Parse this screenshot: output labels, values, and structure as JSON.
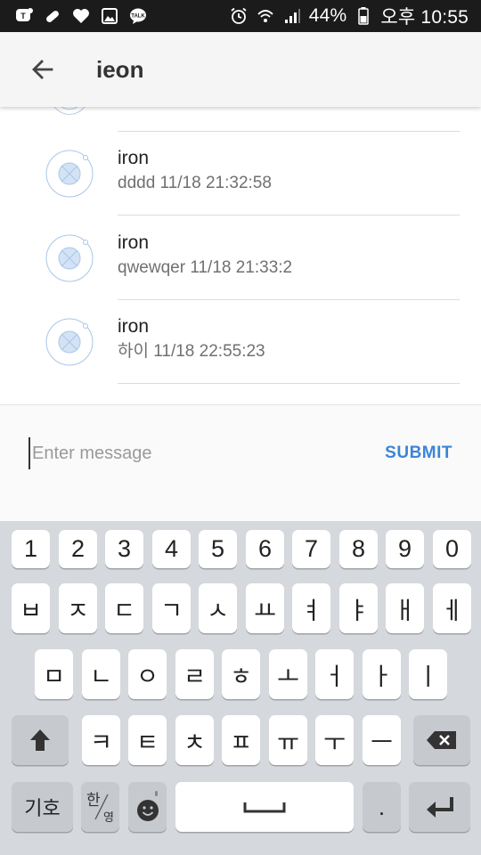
{
  "status_bar": {
    "battery": "44%",
    "time": "오후 10:55",
    "left_icons": [
      "talk-icon",
      "pill-icon",
      "heart-icon",
      "image-icon",
      "kakaotalk-icon"
    ],
    "right_icons": [
      "alarm-icon",
      "wifi-icon",
      "signal-icon",
      "battery-icon"
    ]
  },
  "app_bar": {
    "title": "ieon",
    "back_icon": "arrow-left-icon"
  },
  "messages": [
    {
      "name": "iron",
      "body": "dddd 11/18 21:32:58"
    },
    {
      "name": "iron",
      "body": "qwewqer 11/18 21:33:2"
    },
    {
      "name": "iron",
      "body": "하이 11/18 22:55:23"
    }
  ],
  "composer": {
    "placeholder": "Enter message",
    "submit_label": "SUBMIT"
  },
  "keyboard": {
    "row_numbers": [
      "1",
      "2",
      "3",
      "4",
      "5",
      "6",
      "7",
      "8",
      "9",
      "0"
    ],
    "row_1": [
      "ㅂ",
      "ㅈ",
      "ㄷ",
      "ㄱ",
      "ㅅ",
      "ㅛ",
      "ㅕ",
      "ㅑ",
      "ㅐ",
      "ㅔ"
    ],
    "row_2": [
      "ㅁ",
      "ㄴ",
      "ㅇ",
      "ㄹ",
      "ㅎ",
      "ㅗ",
      "ㅓ",
      "ㅏ",
      "ㅣ"
    ],
    "row_3": [
      "ㅋ",
      "ㅌ",
      "ㅊ",
      "ㅍ",
      "ㅠ",
      "ㅜ",
      "ㅡ"
    ],
    "symbols_label": "기호",
    "lang_label_main": "한",
    "lang_label_sub": "영",
    "period": "."
  },
  "colors": {
    "accent": "#3b85d8",
    "keyboard_bg": "#d5d8dc",
    "status_bar_bg": "#1b1b1b"
  }
}
